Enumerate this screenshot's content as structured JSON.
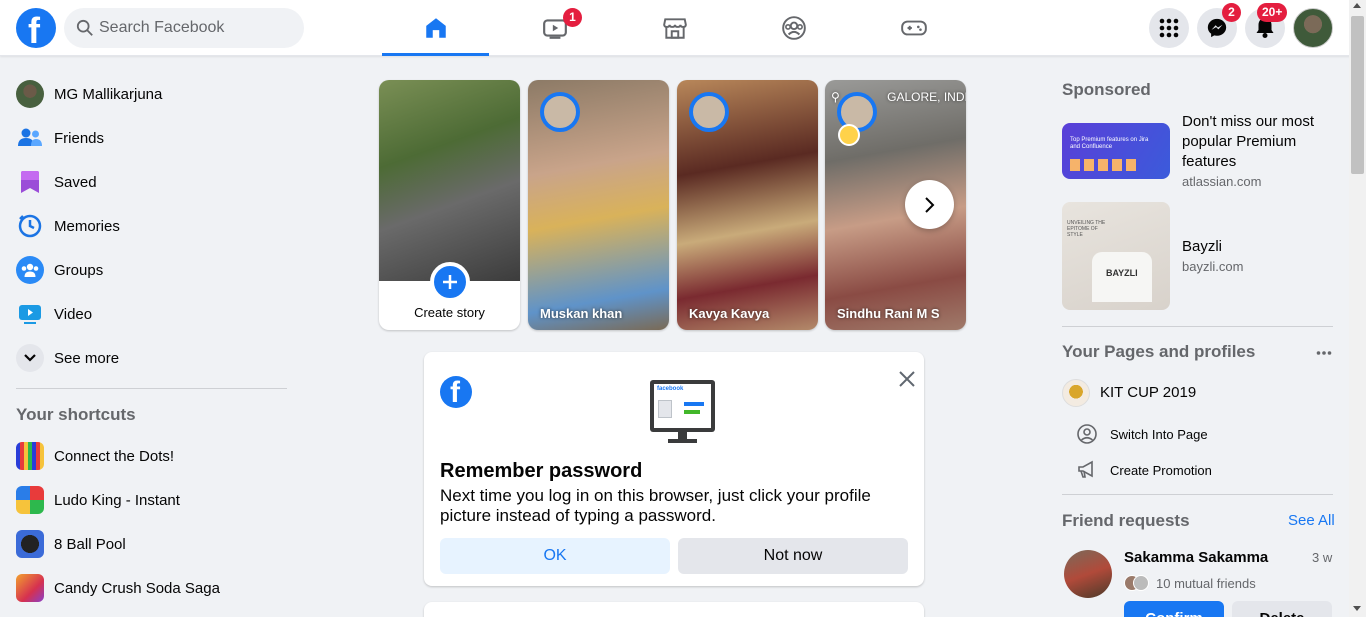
{
  "header": {
    "search_placeholder": "Search Facebook",
    "tabs": [
      {
        "name": "home",
        "active": true,
        "badge": ""
      },
      {
        "name": "watch",
        "active": false,
        "badge": "1"
      },
      {
        "name": "marketplace",
        "active": false,
        "badge": ""
      },
      {
        "name": "groups",
        "active": false,
        "badge": ""
      },
      {
        "name": "gaming",
        "active": false,
        "badge": ""
      }
    ],
    "messenger_badge": "2",
    "notifications_badge": "20+"
  },
  "sidebar": {
    "items": [
      {
        "label": "MG Mallikarjuna",
        "icon": "profile-avatar"
      },
      {
        "label": "Friends",
        "icon": "friends-icon"
      },
      {
        "label": "Saved",
        "icon": "bookmark-icon"
      },
      {
        "label": "Memories",
        "icon": "clock-icon"
      },
      {
        "label": "Groups",
        "icon": "groups-icon"
      },
      {
        "label": "Video",
        "icon": "video-icon"
      },
      {
        "label": "See more",
        "icon": "chevron-down-icon"
      }
    ],
    "shortcuts_title": "Your shortcuts",
    "shortcuts": [
      {
        "label": "Connect the Dots!"
      },
      {
        "label": "Ludo King - Instant"
      },
      {
        "label": "8 Ball Pool"
      },
      {
        "label": "Candy Crush Soda Saga"
      }
    ]
  },
  "stories": {
    "create_label": "Create story",
    "items": [
      {
        "name": "Muskan khan"
      },
      {
        "name": "Kavya Kavya"
      },
      {
        "name": "Sindhu Rani M S",
        "location": "BENGALURU, INDIA",
        "location_visible": "GALORE, INDIA"
      }
    ]
  },
  "remember_card": {
    "title": "Remember password",
    "body": "Next time you log in on this browser, just click your profile picture instead of typing a password.",
    "ok_label": "OK",
    "not_now_label": "Not now",
    "monitor_brand": "facebook"
  },
  "right": {
    "sponsored_title": "Sponsored",
    "ads": [
      {
        "title": "Don't miss our most popular Premium features",
        "domain": "atlassian.com",
        "image_text": "Top Premium features on Jira and Confluence"
      },
      {
        "title": "Bayzli",
        "domain": "bayzli.com",
        "image_text": "UNVEILING THE EPITOME OF STYLE",
        "shirt_text": "BAYZLI"
      }
    ],
    "pages_title": "Your Pages and profiles",
    "page_name": "KIT CUP 2019",
    "switch_label": "Switch Into Page",
    "promo_label": "Create Promotion",
    "friend_requests_title": "Friend requests",
    "see_all": "See All",
    "request": {
      "name": "Sakamma Sakamma",
      "time": "3 w",
      "mutual": "10 mutual friends",
      "confirm": "Confirm",
      "delete": "Delete"
    }
  },
  "colors": {
    "brand": "#1877f2",
    "badge": "#e41e3f",
    "background": "#f0f2f5"
  }
}
